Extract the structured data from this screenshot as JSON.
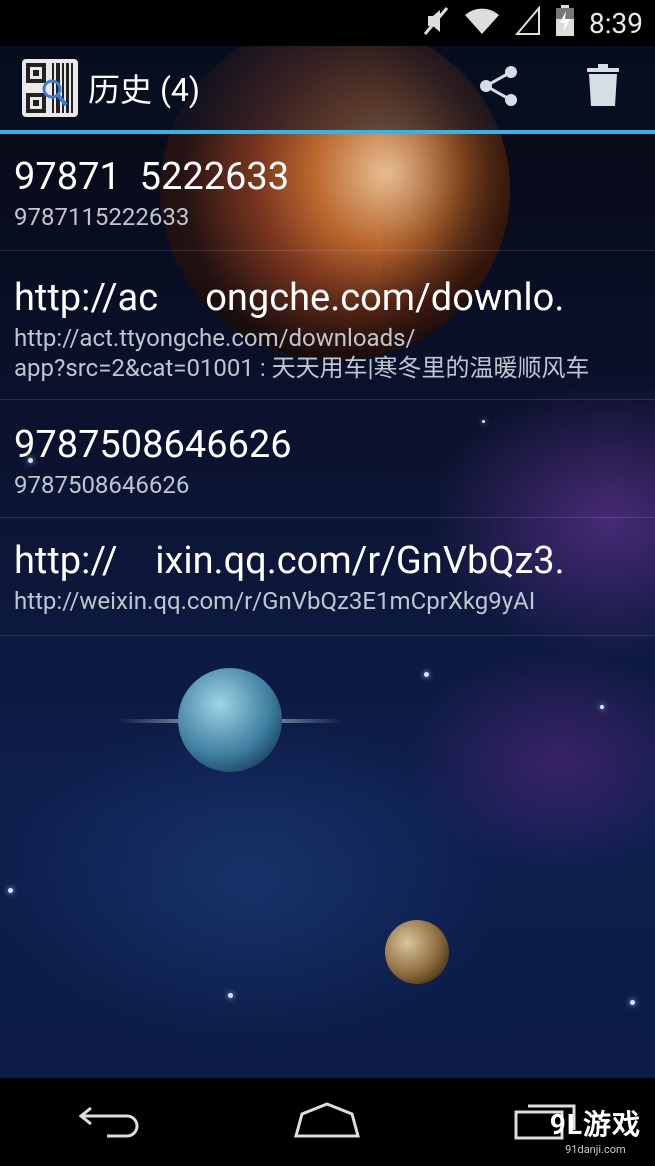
{
  "status_bar": {
    "time": "8:39",
    "icons": [
      "mute-icon",
      "wifi-icon",
      "signal-icon",
      "battery-charging-icon"
    ]
  },
  "action_bar": {
    "title": "历史 (4)",
    "app_icon": "barcode-scanner-icon",
    "actions": [
      "share-icon",
      "trash-icon"
    ]
  },
  "history": [
    {
      "primary": "97871  5222633",
      "secondary": "9787115222633"
    },
    {
      "primary": "http://ac     ongche.com/downlo.",
      "secondary": "http://act.ttyongche.com/downloads/\napp?src=2&cat=01001 : 天天用车|寒冬里的温暖顺风车"
    },
    {
      "primary": "9787508646626",
      "secondary": "9787508646626"
    },
    {
      "primary": "http://    ixin.qq.com/r/GnVbQz3.",
      "secondary": "http://weixin.qq.com/r/GnVbQz3E1mCprXkg9yAI"
    }
  ],
  "nav_bar": {
    "buttons": [
      "back-icon",
      "home-icon",
      "recents-icon"
    ]
  },
  "watermark": {
    "main": "9L游戏",
    "sub": "91danji.com"
  }
}
